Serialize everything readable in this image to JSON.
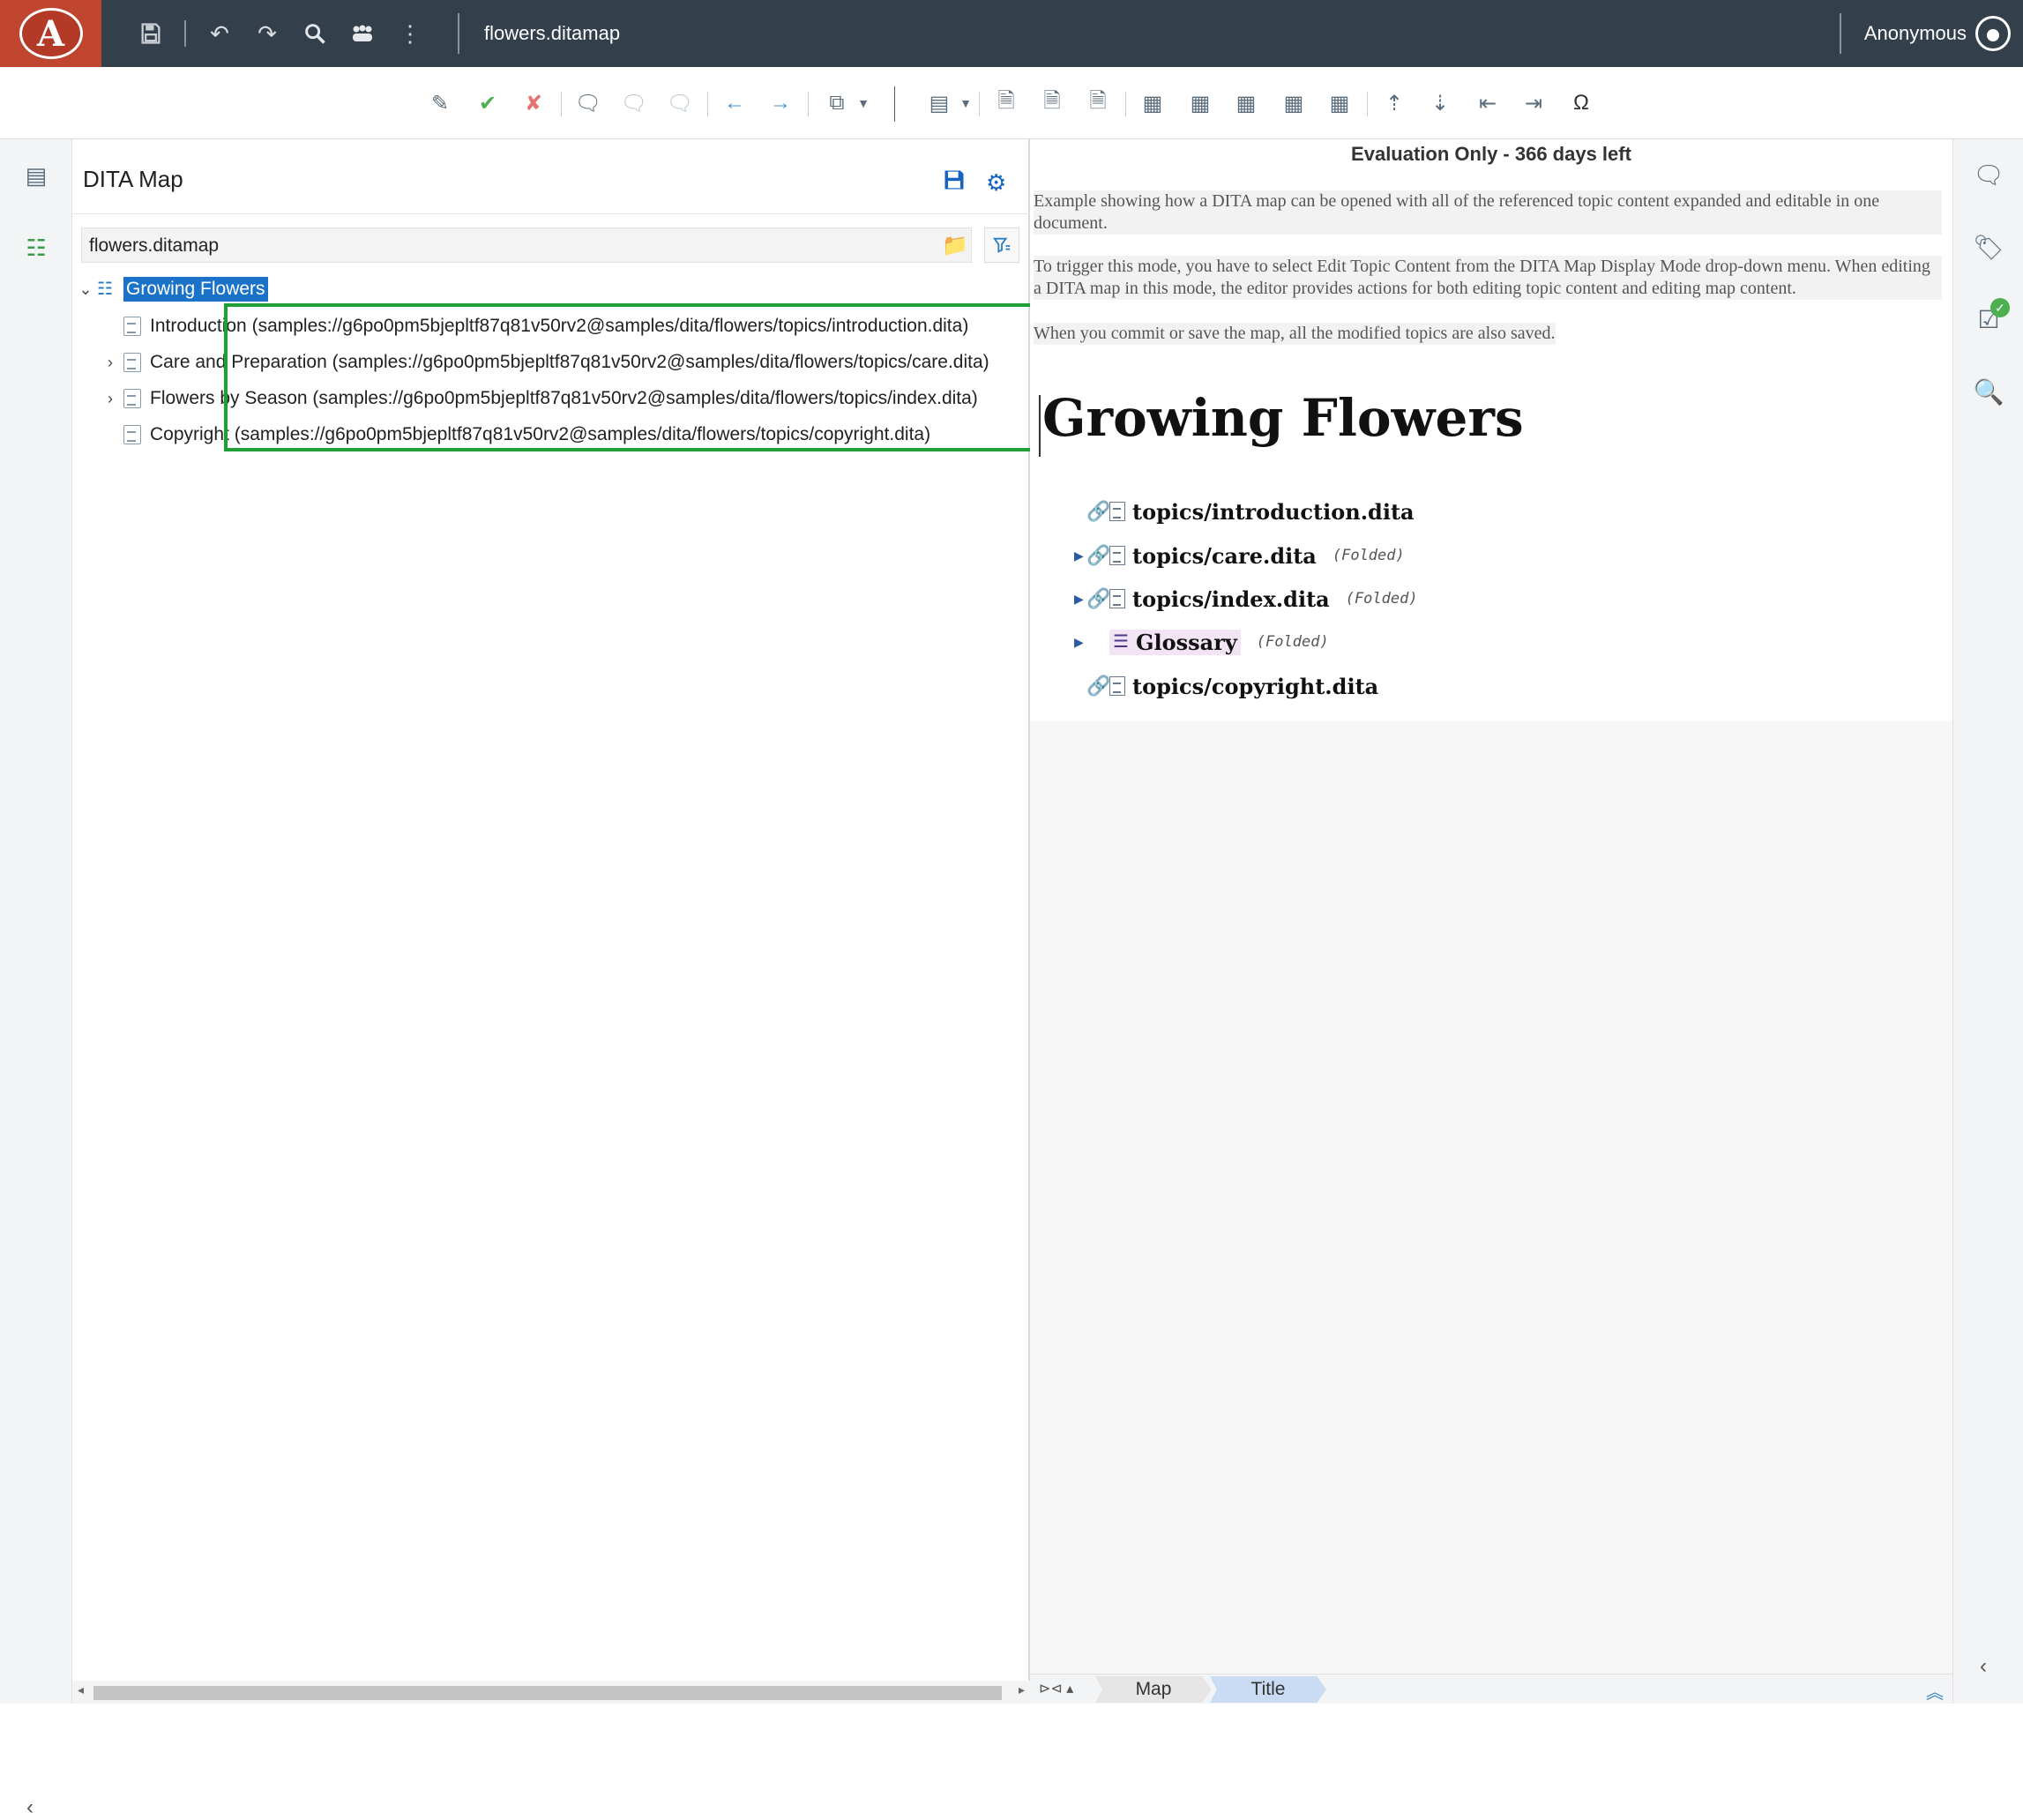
{
  "app": {
    "logo_letter": "A",
    "document_title": "flowers.ditamap",
    "user_name": "Anonymous"
  },
  "map_panel": {
    "title": "DITA Map",
    "map_file": "flowers.ditamap",
    "root": {
      "label": "Growing Flowers",
      "selected": true
    },
    "items": [
      {
        "label": "Introduction (samples://g6po0pm5bjepltf87q81v50rv2@samples/dita/flowers/topics/introduction.dita)",
        "expandable": false
      },
      {
        "label": "Care and Preparation (samples://g6po0pm5bjepltf87q81v50rv2@samples/dita/flowers/topics/care.dita)",
        "expandable": true
      },
      {
        "label": "Flowers by Season (samples://g6po0pm5bjepltf87q81v50rv2@samples/dita/flowers/topics/index.dita)",
        "expandable": true
      },
      {
        "label": "Copyright (samples://g6po0pm5bjepltf87q81v50rv2@samples/dita/flowers/topics/copyright.dita)",
        "expandable": false
      }
    ]
  },
  "editor": {
    "evaluation_notice": "Evaluation Only - 366 days left",
    "description": [
      "Example showing how a DITA map can be opened with all of the referenced topic content expanded and editable in one document.",
      "To trigger this mode, you have to select Edit Topic Content from the DITA Map Display Mode drop-down menu. When editing a DITA map in this mode, the editor provides actions for both editing topic content and editing map content.",
      "When you commit or save the map, all the modified topics are also saved."
    ],
    "heading": "Growing Flowers",
    "refs": [
      {
        "label": "topics/introduction.dita",
        "folded": "",
        "expandable": false,
        "kind": "topicref"
      },
      {
        "label": "topics/care.dita",
        "folded": "(Folded)",
        "expandable": true,
        "kind": "topicref"
      },
      {
        "label": "topics/index.dita",
        "folded": "(Folded)",
        "expandable": true,
        "kind": "topicref"
      },
      {
        "label": "Glossary",
        "folded": "(Folded)",
        "expandable": true,
        "kind": "topichead"
      },
      {
        "label": "topics/copyright.dita",
        "folded": "",
        "expandable": false,
        "kind": "topicref"
      }
    ]
  },
  "status_bar": {
    "breadcrumbs": [
      "Map",
      "Title"
    ]
  },
  "colors": {
    "topbar": "#333f4a",
    "logo_bg": "#c0452e",
    "selection": "#1a73c9",
    "highlight_box": "#1f9e3a"
  }
}
